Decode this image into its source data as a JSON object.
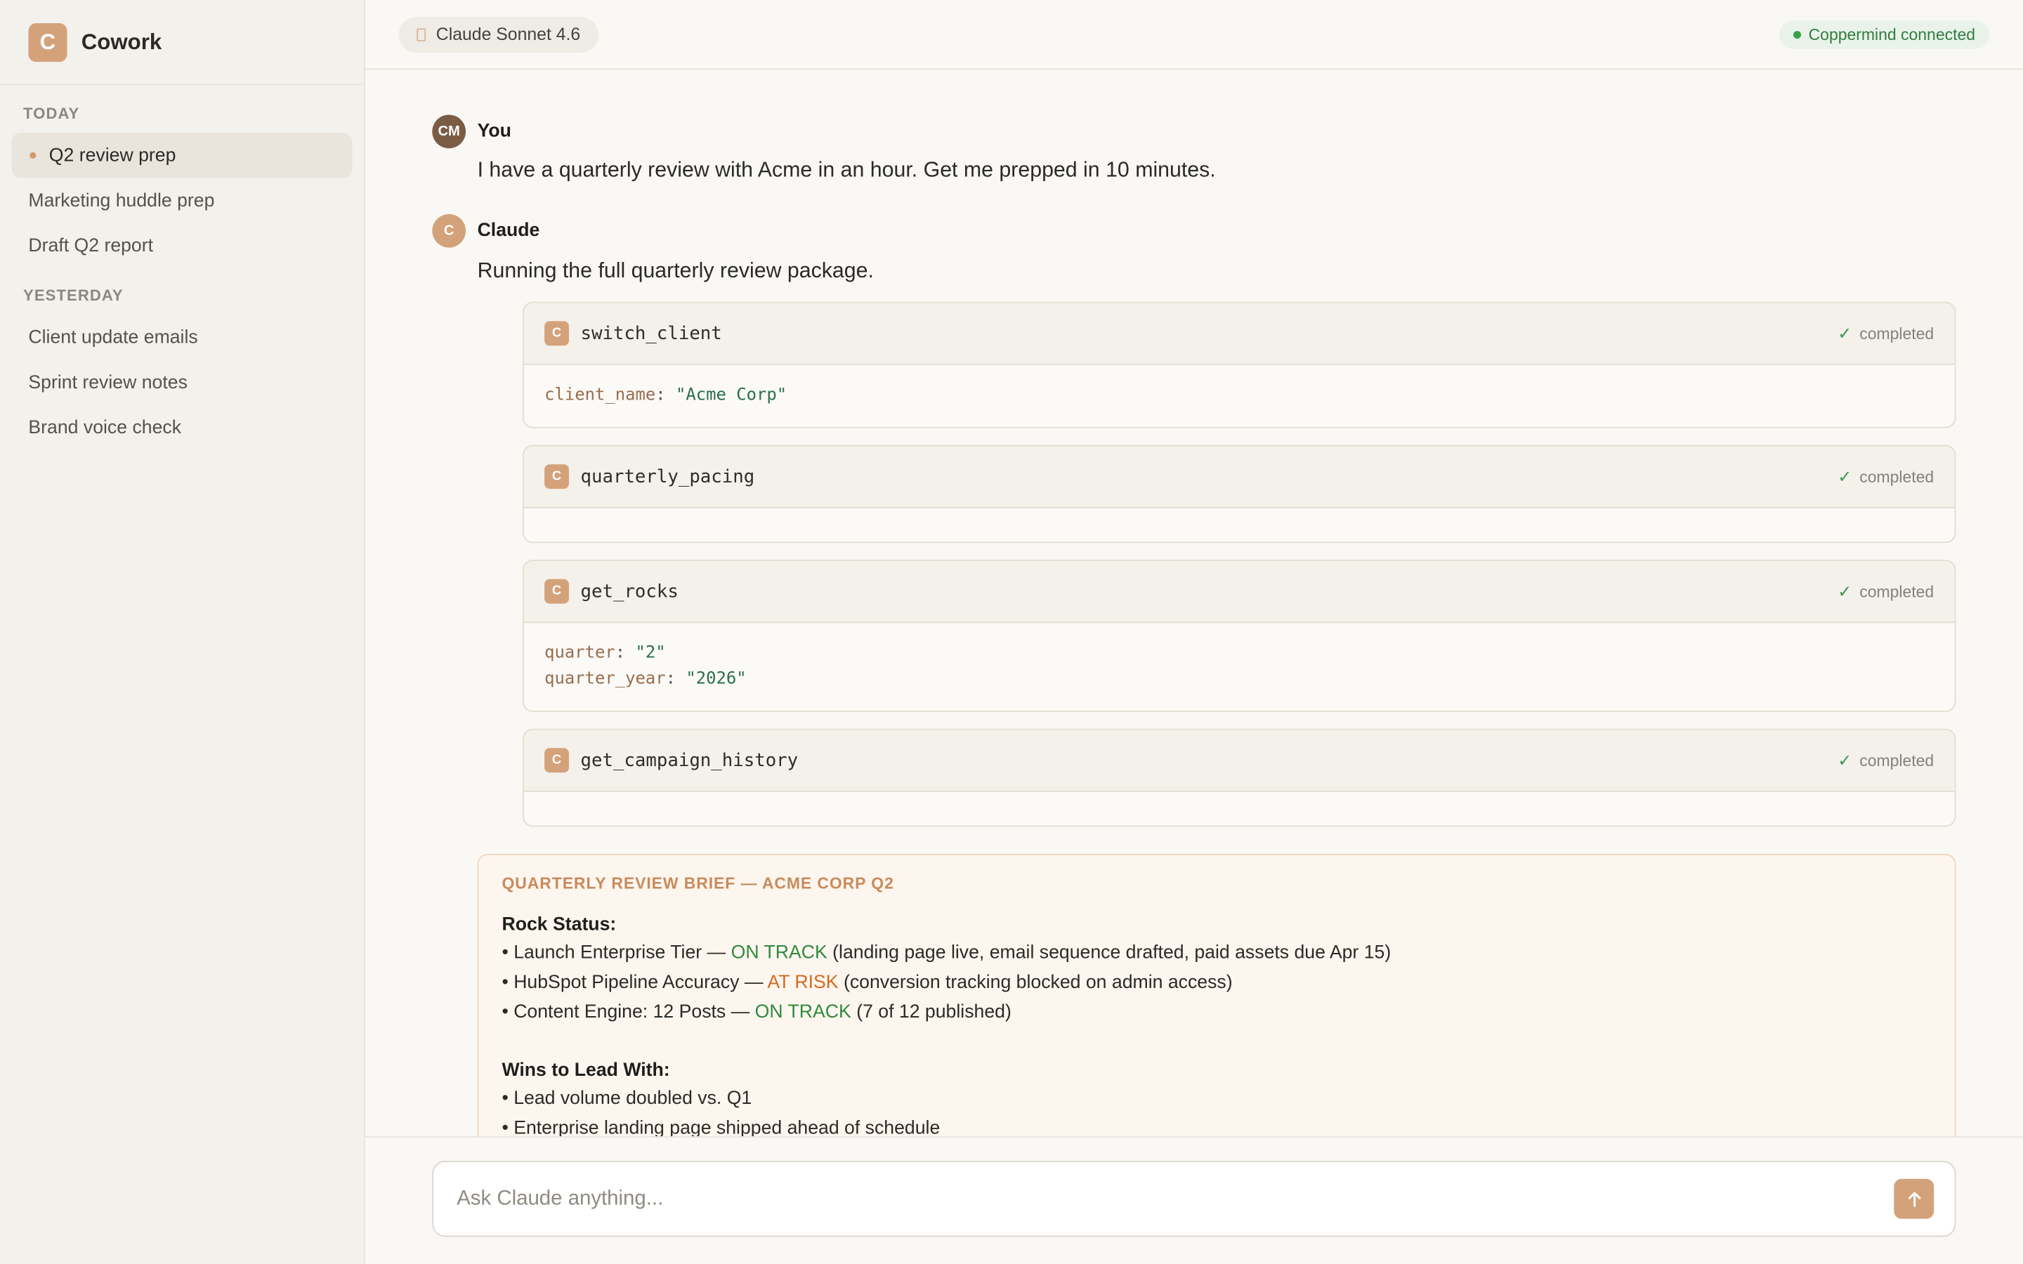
{
  "app": {
    "logo_letter": "C",
    "name": "Cowork"
  },
  "sidebar": {
    "today_title": "TODAY",
    "today_items": [
      {
        "label": "Q2 review prep",
        "active": true
      },
      {
        "label": "Marketing huddle prep"
      },
      {
        "label": "Draft Q2 report"
      }
    ],
    "yesterday_title": "YESTERDAY",
    "yesterday_items": [
      {
        "label": "Client update emails"
      },
      {
        "label": "Sprint review notes"
      },
      {
        "label": "Brand voice check"
      }
    ]
  },
  "topbar": {
    "model": "Claude Sonnet 4.6",
    "connection": "Coppermind connected"
  },
  "messages": {
    "user": {
      "initials": "CM",
      "name": "You",
      "text": "I have a quarterly review with Acme in an hour. Get me prepped in 10 minutes."
    },
    "claude": {
      "initials": "C",
      "name": "Claude",
      "text": "Running the full quarterly review package."
    }
  },
  "tools": [
    {
      "badge": "C",
      "name": "switch_client",
      "status": "completed",
      "args": [
        {
          "key": "client_name",
          "value": "\"Acme Corp\""
        }
      ]
    },
    {
      "badge": "C",
      "name": "quarterly_pacing",
      "status": "completed",
      "args": []
    },
    {
      "badge": "C",
      "name": "get_rocks",
      "status": "completed",
      "args": [
        {
          "key": "quarter",
          "value": "\"2\""
        },
        {
          "key": "quarter_year",
          "value": "\"2026\""
        }
      ]
    },
    {
      "badge": "C",
      "name": "get_campaign_history",
      "status": "completed",
      "args": []
    }
  ],
  "brief": {
    "title": "QUARTERLY REVIEW BRIEF — ACME CORP Q2",
    "rock_heading": "Rock Status:",
    "rocks": [
      {
        "pre": "• Launch Enterprise Tier — ",
        "status": "ON TRACK",
        "status_kind": "green",
        "post": " (landing page live, email sequence drafted, paid assets due Apr 15)"
      },
      {
        "pre": "• HubSpot Pipeline Accuracy — ",
        "status": "AT RISK",
        "status_kind": "orange",
        "post": " (conversion tracking blocked on admin access)"
      },
      {
        "pre": "• Content Engine: 12 Posts — ",
        "status": "ON TRACK",
        "status_kind": "green",
        "post": " (7 of 12 published)"
      }
    ],
    "wins_heading": "Wins to Lead With:",
    "wins": [
      "• Lead volume doubled vs. Q1",
      "• Enterprise landing page shipped ahead of schedule"
    ]
  },
  "composer": {
    "placeholder": "Ask Claude anything...",
    "send_icon": "arrow-up-icon"
  },
  "colors": {
    "accent": "#d4a27a",
    "on_track": "#2f8a3c",
    "at_risk": "#d46a22",
    "connected": "#2f7d3e"
  }
}
